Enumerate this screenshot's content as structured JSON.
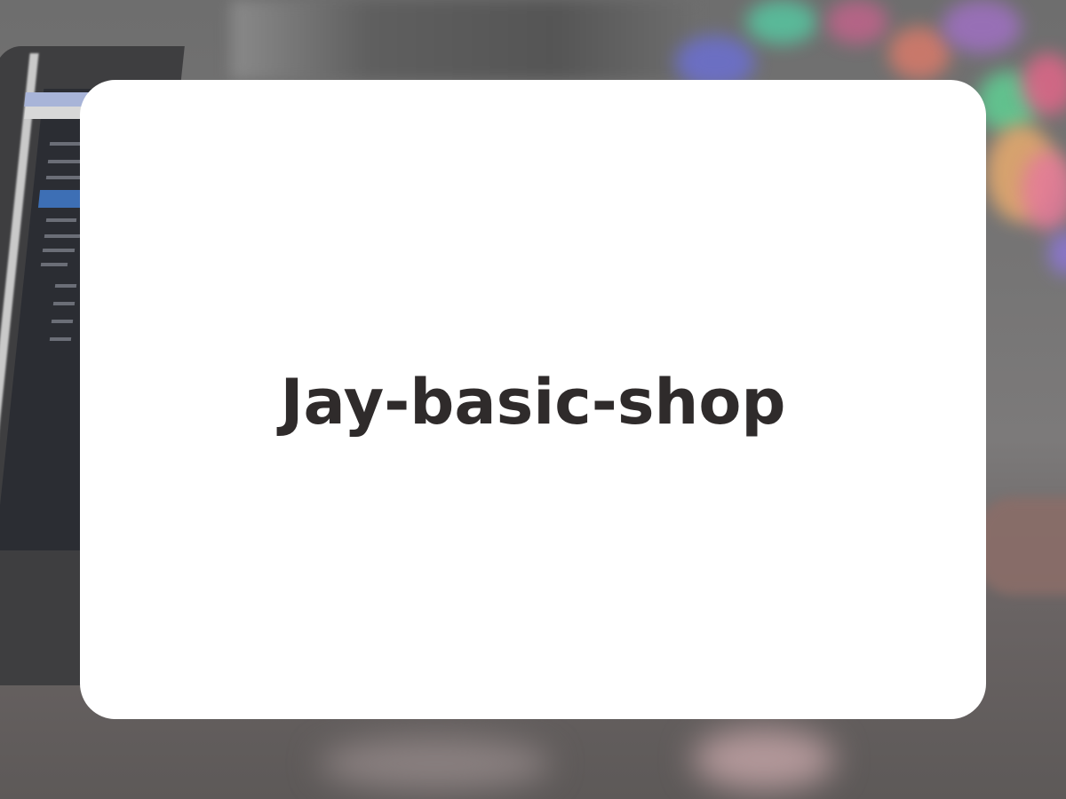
{
  "title": "Jay-basic-shop",
  "background": {
    "description_color": "#767575",
    "icon": "laptop-photo-background"
  },
  "colors": {
    "card": "#ffffff",
    "text": "#2f2b2b"
  }
}
